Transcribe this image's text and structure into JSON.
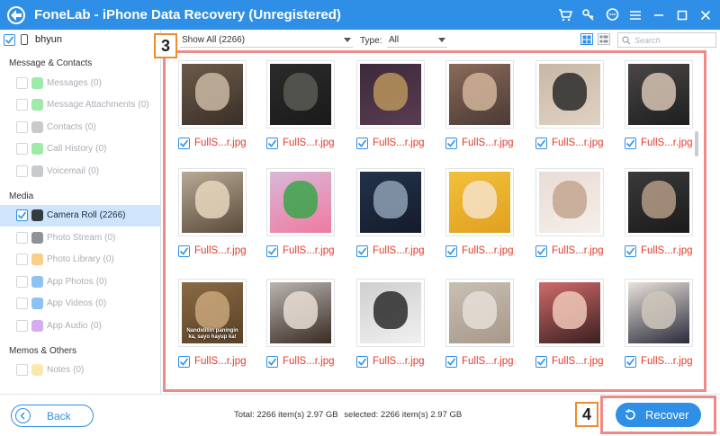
{
  "app": {
    "title": "FoneLab - iPhone Data Recovery (Unregistered)",
    "controls": [
      "cart-icon",
      "key-icon",
      "chat-icon",
      "menu-icon",
      "minimize-icon",
      "maximize-icon",
      "close-icon"
    ]
  },
  "sidebar": {
    "device": {
      "name": "bhyun",
      "checked": true
    },
    "sections": [
      {
        "title": "Message & Contacts",
        "items": [
          {
            "label": "Messages",
            "count": "(0)",
            "icon": "messages-icon",
            "icon_color": "#4cd964"
          },
          {
            "label": "Message Attachments",
            "count": "(0)",
            "icon": "message-attachments-icon",
            "icon_color": "#4cd964"
          },
          {
            "label": "Contacts",
            "count": "(0)",
            "icon": "contacts-icon",
            "icon_color": "#9aa0a6"
          },
          {
            "label": "Call History",
            "count": "(0)",
            "icon": "call-history-icon",
            "icon_color": "#4cd964"
          },
          {
            "label": "Voicemail",
            "count": "(0)",
            "icon": "voicemail-icon",
            "icon_color": "#9aa0a6"
          }
        ]
      },
      {
        "title": "Media",
        "items": [
          {
            "label": "Camera Roll",
            "count": "(2266)",
            "icon": "camera-roll-icon",
            "icon_color": "#333a40",
            "active": true,
            "checked": true
          },
          {
            "label": "Photo Stream",
            "count": "(0)",
            "icon": "photo-stream-icon",
            "icon_color": "#333a40"
          },
          {
            "label": "Photo Library",
            "count": "(0)",
            "icon": "photo-library-icon",
            "icon_color": "#f5a623"
          },
          {
            "label": "App Photos",
            "count": "(0)",
            "icon": "app-photos-icon",
            "icon_color": "#2f8fe6"
          },
          {
            "label": "App Videos",
            "count": "(0)",
            "icon": "app-videos-icon",
            "icon_color": "#2f8fe6"
          },
          {
            "label": "App Audio",
            "count": "(0)",
            "icon": "app-audio-icon",
            "icon_color": "#b36ae2"
          }
        ]
      },
      {
        "title": "Memos & Others",
        "items": [
          {
            "label": "Notes",
            "count": "(0)",
            "icon": "notes-icon",
            "icon_color": "#f5d76e"
          }
        ]
      }
    ]
  },
  "toolbar": {
    "show_filter": "Show All (2266)",
    "type_label": "Type:",
    "type_value": "All",
    "search_placeholder": "Search"
  },
  "photos": [
    {
      "name": "FullS...r.jpg",
      "colors": [
        "#6b5a4a",
        "#c9b8a3",
        "#3a3028"
      ]
    },
    {
      "name": "FullS...r.jpg",
      "colors": [
        "#2b2b2b",
        "#5a5a55",
        "#1a1a1a"
      ]
    },
    {
      "name": "FullS...r.jpg",
      "colors": [
        "#3c2a3a",
        "#b8945a",
        "#5a3c52"
      ]
    },
    {
      "name": "FullS...r.jpg",
      "colors": [
        "#8a6a5a",
        "#d2b49a",
        "#4a3a35"
      ]
    },
    {
      "name": "FullS...r.jpg",
      "colors": [
        "#c7b7a7",
        "#2a2a2a",
        "#e0d2c2"
      ]
    },
    {
      "name": "FullS...r.jpg",
      "colors": [
        "#4a4646",
        "#d6c4b4",
        "#1e1e1e"
      ]
    },
    {
      "name": "FullS...r.jpg",
      "colors": [
        "#b8aa95",
        "#e6d7bd",
        "#5a4a3a"
      ]
    },
    {
      "name": "FullS...r.jpg",
      "colors": [
        "#d8b8d8",
        "#3aa64a",
        "#f07aa0"
      ]
    },
    {
      "name": "FullS...r.jpg",
      "colors": [
        "#23324a",
        "#8fa0b4",
        "#141c2a"
      ]
    },
    {
      "name": "FullS...r.jpg",
      "colors": [
        "#f2c13a",
        "#f7e2c9",
        "#e0a020"
      ]
    },
    {
      "name": "FullS...r.jpg",
      "colors": [
        "#eadbd5",
        "#c3a590",
        "#f5efe9"
      ]
    },
    {
      "name": "FullS...r.jpg",
      "colors": [
        "#3a3a3a",
        "#b49a85",
        "#1a1a1a"
      ]
    },
    {
      "name": "FullS...r.jpg",
      "colors": [
        "#8a6a45",
        "#c9a67a",
        "#5a4026"
      ]
    },
    {
      "name": "FullS...r.jpg",
      "colors": [
        "#b9b5b2",
        "#e8ddd5",
        "#3a2a22"
      ]
    },
    {
      "name": "FullS...r.jpg",
      "colors": [
        "#cfcfcf",
        "#2a2a2a",
        "#f0f0f0"
      ]
    },
    {
      "name": "FullS...r.jpg",
      "colors": [
        "#c8bfb4",
        "#e6dfd6",
        "#a69888"
      ]
    },
    {
      "name": "FullS...r.jpg",
      "colors": [
        "#d06a6a",
        "#f0c8b8",
        "#3a2020"
      ]
    },
    {
      "name": "FullS...r.jpg",
      "colors": [
        "#e8e2da",
        "#cfc7bc",
        "#2a2a3a"
      ]
    }
  ],
  "photo_caption": "Nandidiliin paningin ka, sayo hayup ka!",
  "footer": {
    "back_label": "Back",
    "total": "Total: 2266 item(s) 2.97 GB",
    "selected": "selected: 2266 item(s) 2.97 GB",
    "recover_label": "Recover"
  },
  "badges": {
    "step3": "3",
    "step4": "4"
  },
  "colors": {
    "accent": "#2f8fe6",
    "highlight_frame": "#ee8a8a",
    "badge_border": "#f08b2d",
    "file_name": "#e23b2b"
  }
}
